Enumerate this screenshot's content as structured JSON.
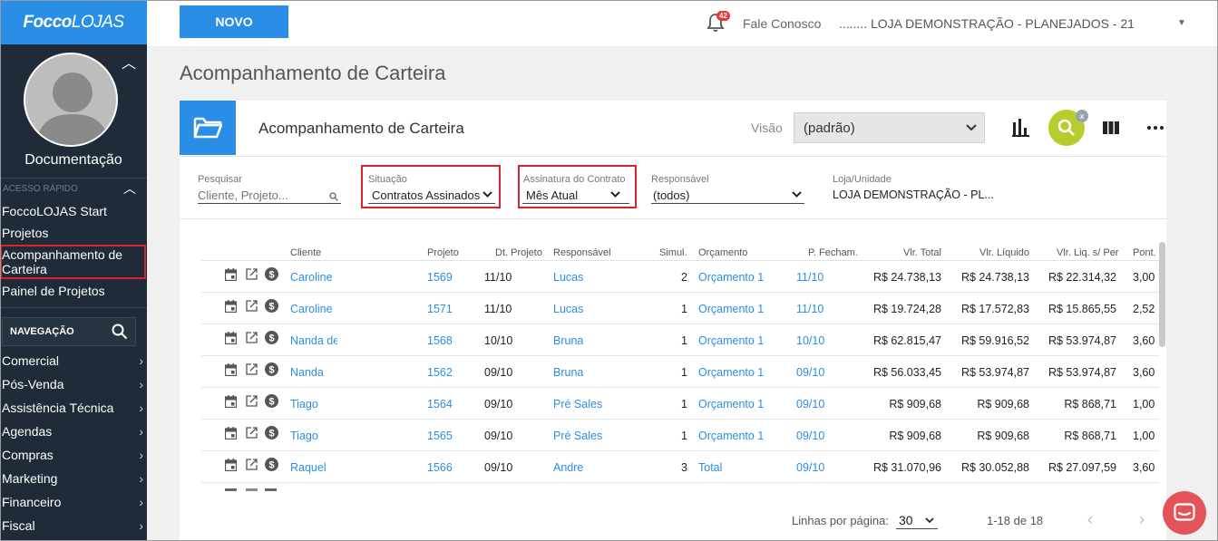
{
  "app": {
    "logo_bold": "Focco",
    "logo_thin": "LOJAS"
  },
  "sidebar": {
    "username": "Documentação",
    "quick_access_label": "ACESSO RÁPIDO",
    "quick_links": [
      "FoccoLOJAS Start",
      "Projetos",
      "Acompanhamento de Carteira",
      "Painel de Projetos"
    ],
    "nav_label": "NAVEGAÇÃO",
    "menu": [
      "Comercial",
      "Pós-Venda",
      "Assistência Técnica",
      "Agendas",
      "Compras",
      "Marketing",
      "Financeiro",
      "Fiscal"
    ]
  },
  "topbar": {
    "new_button": "NOVO",
    "notification_count": "42",
    "contact_label": "Fale Conosco",
    "store_name": "........ LOJA DEMONSTRAÇÃO - PLANEJADOS - 21"
  },
  "page": {
    "title": "Acompanhamento de Carteira"
  },
  "card": {
    "title": "Acompanhamento de Carteira",
    "view_label": "Visão",
    "view_value": "(padrão)",
    "clear_badge": "x"
  },
  "filters": {
    "search": {
      "label": "Pesquisar",
      "placeholder": "Cliente, Projeto..."
    },
    "status": {
      "label": "Situação",
      "value": "Contratos Assinados"
    },
    "signature": {
      "label": "Assinatura do Contrato",
      "value": "Mês Atual"
    },
    "responsible": {
      "label": "Responsável",
      "value": "(todos)"
    },
    "store": {
      "label": "Loja/Unidade",
      "value": "LOJA DEMONSTRAÇÃO - PL..."
    }
  },
  "table": {
    "headers": {
      "cliente": "Cliente",
      "projeto": "Projeto",
      "dt_projeto": "Dt. Projeto",
      "responsavel": "Responsável",
      "simul": "Simul.",
      "orcamento": "Orçamento",
      "p_fecham": "P. Fecham.",
      "vlr_total": "Vlr. Total",
      "vlr_liquido": "Vlr. Líquido",
      "vlr_liq_per": "Vlr. Liq. s/ Per",
      "pont": "Pont."
    },
    "rows": [
      {
        "cliente": "Caroline",
        "projeto": "1569",
        "dt_projeto": "11/10",
        "responsavel": "Lucas",
        "simul": "2",
        "orcamento": "Orçamento 1",
        "p_fecham": "11/10",
        "vlr_total": "R$ 24.738,13",
        "vlr_liquido": "R$ 24.738,13",
        "vlr_liq_per": "R$ 22.314,32",
        "pont": "3,00"
      },
      {
        "cliente": "Caroline",
        "projeto": "1571",
        "dt_projeto": "11/10",
        "responsavel": "Lucas",
        "simul": "1",
        "orcamento": "Orçamento 1",
        "p_fecham": "11/10",
        "vlr_total": "R$ 19.724,28",
        "vlr_liquido": "R$ 17.572,83",
        "vlr_liq_per": "R$ 15.865,55",
        "pont": "2,52"
      },
      {
        "cliente": "Nanda de",
        "projeto": "1568",
        "dt_projeto": "10/10",
        "responsavel": "Bruna",
        "simul": "1",
        "orcamento": "Orçamento 1",
        "p_fecham": "10/10",
        "vlr_total": "R$ 62.815,47",
        "vlr_liquido": "R$ 59.916,52",
        "vlr_liq_per": "R$ 53.974,87",
        "pont": "3,60"
      },
      {
        "cliente": "Nanda",
        "projeto": "1562",
        "dt_projeto": "09/10",
        "responsavel": "Bruna",
        "simul": "1",
        "orcamento": "Orçamento 1",
        "p_fecham": "09/10",
        "vlr_total": "R$ 56.033,45",
        "vlr_liquido": "R$ 53.974,87",
        "vlr_liq_per": "R$ 53.974,87",
        "pont": "3,60"
      },
      {
        "cliente": "Tiago",
        "projeto": "1564",
        "dt_projeto": "09/10",
        "responsavel": "Pré Sales",
        "simul": "1",
        "orcamento": "Orçamento 1",
        "p_fecham": "09/10",
        "vlr_total": "R$ 909,68",
        "vlr_liquido": "R$ 909,68",
        "vlr_liq_per": "R$ 868,71",
        "pont": "1,00"
      },
      {
        "cliente": "Tiago",
        "projeto": "1565",
        "dt_projeto": "09/10",
        "responsavel": "Pré Sales",
        "simul": "1",
        "orcamento": "Orçamento 1",
        "p_fecham": "09/10",
        "vlr_total": "R$ 909,68",
        "vlr_liquido": "R$ 909,68",
        "vlr_liq_per": "R$ 868,71",
        "pont": "1,00"
      },
      {
        "cliente": "Raquel",
        "projeto": "1566",
        "dt_projeto": "09/10",
        "responsavel": "Andre",
        "simul": "3",
        "orcamento": "Total",
        "p_fecham": "09/10",
        "vlr_total": "R$ 31.070,96",
        "vlr_liquido": "R$ 30.052,88",
        "vlr_liq_per": "R$ 27.097,59",
        "pont": "3,60"
      }
    ]
  },
  "pagination": {
    "rows_label": "Linhas por página:",
    "rows_value": "30",
    "range": "1-18 de 18"
  },
  "colors": {
    "primary": "#2a8ee6",
    "sidebar": "#1f2b38",
    "highlight": "#d9222a",
    "search_active": "#b8cc2e",
    "chat": "#e2545a"
  }
}
